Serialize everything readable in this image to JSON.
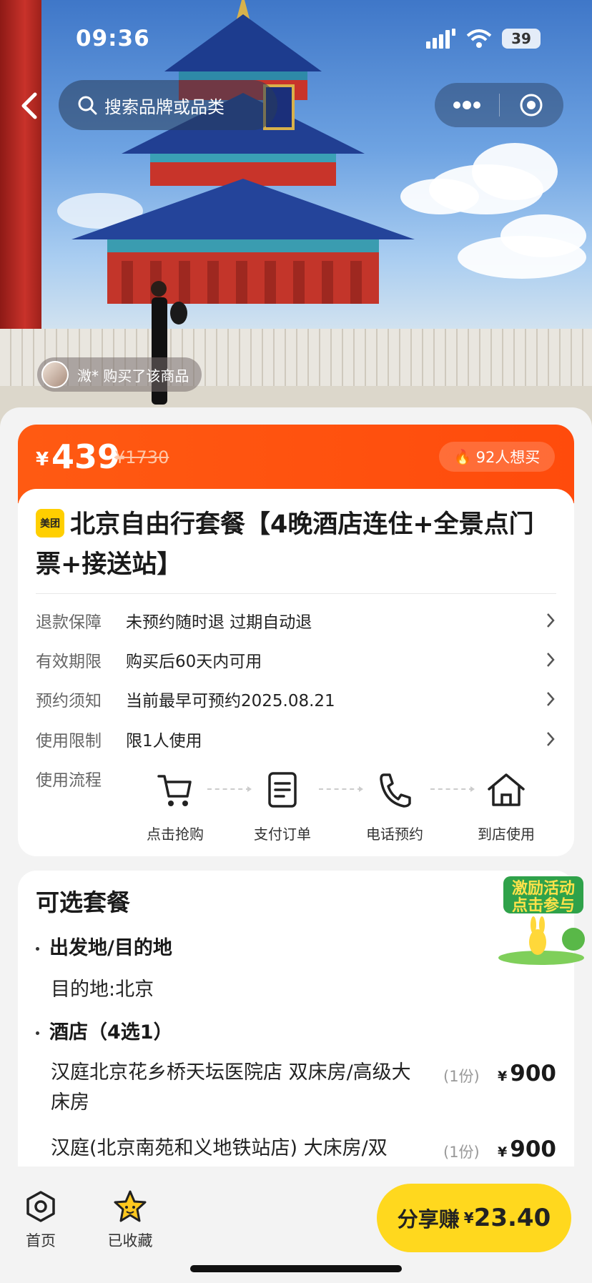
{
  "status": {
    "time": "09:36",
    "battery": "39"
  },
  "search": {
    "placeholder": "搜索品牌或品类"
  },
  "buyer_notice": "溦* 购买了该商品",
  "price": {
    "currency": "¥",
    "current": "439",
    "original": "¥1730",
    "want": "92人想买"
  },
  "brand_badge": "美团",
  "title": "北京自由行套餐【4晚酒店连住+全景点门票+接送站】",
  "info_rows": [
    {
      "key": "退款保障",
      "value": "未预约随时退 过期自动退"
    },
    {
      "key": "有效期限",
      "value": "购买后60天内可用"
    },
    {
      "key": "预约须知",
      "value": "当前最早可预约2025.08.21"
    },
    {
      "key": "使用限制",
      "value": "限1人使用"
    }
  ],
  "flow": {
    "label": "使用流程",
    "steps": [
      {
        "label": "点击抢购",
        "icon": "cart-icon"
      },
      {
        "label": "支付订单",
        "icon": "document-icon"
      },
      {
        "label": "电话预约",
        "icon": "phone-icon"
      },
      {
        "label": "到店使用",
        "icon": "home-icon"
      }
    ]
  },
  "packages": {
    "title": "可选套餐",
    "origin_heading": "出发地/目的地",
    "destination": "目的地:北京",
    "hotel_heading": "酒店（4选1）",
    "hotels": [
      {
        "name": "汉庭北京花乡桥天坛医院店 双床房/高级大床房",
        "qty": "(1份)",
        "currency": "¥",
        "price": "900"
      },
      {
        "name": "汉庭(北京南苑和义地铁站店) 大床房/双",
        "qty": "(1份)",
        "currency": "¥",
        "price": "900"
      }
    ]
  },
  "promo": {
    "line1": "激励活动",
    "line2": "点击参与"
  },
  "bottom_bar": {
    "home_label": "首页",
    "favorites_label": "已收藏",
    "share_label": "分享赚",
    "share_currency": "¥",
    "share_amount": "23.40"
  },
  "colors": {
    "accent_orange": "#ff5a12",
    "accent_yellow": "#ffd81e"
  }
}
